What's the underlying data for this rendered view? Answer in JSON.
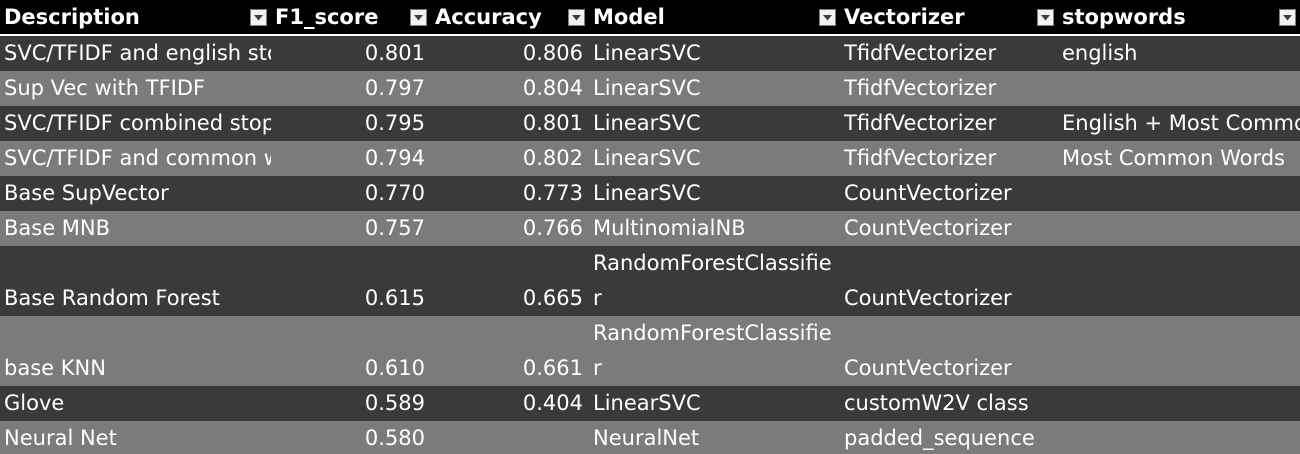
{
  "columns": [
    {
      "label": "Description"
    },
    {
      "label": "F1_score"
    },
    {
      "label": "Accuracy"
    },
    {
      "label": "Model"
    },
    {
      "label": "Vectorizer"
    },
    {
      "label": "stopwords"
    }
  ],
  "rows": [
    {
      "description": "SVC/TFIDF and english stopwords",
      "f1": "0.801",
      "accuracy": "0.806",
      "model": "LinearSVC",
      "vectorizer": "TfidfVectorizer",
      "stopwords": "english"
    },
    {
      "description": "Sup Vec with TFIDF",
      "f1": "0.797",
      "accuracy": "0.804",
      "model": "LinearSVC",
      "vectorizer": "TfidfVectorizer",
      "stopwords": ""
    },
    {
      "description": "SVC/TFIDF combined stopwords",
      "f1": "0.795",
      "accuracy": "0.801",
      "model": "LinearSVC",
      "vectorizer": "TfidfVectorizer",
      "stopwords": "English + Most Common Words"
    },
    {
      "description": "SVC/TFIDF and common words",
      "f1": "0.794",
      "accuracy": "0.802",
      "model": "LinearSVC",
      "vectorizer": "TfidfVectorizer",
      "stopwords": "Most Common Words"
    },
    {
      "description": "Base SupVector",
      "f1": "0.770",
      "accuracy": "0.773",
      "model": "LinearSVC",
      "vectorizer": "CountVectorizer",
      "stopwords": ""
    },
    {
      "description": "Base MNB",
      "f1": "0.757",
      "accuracy": "0.766",
      "model": "MultinomialNB",
      "vectorizer": "CountVectorizer",
      "stopwords": ""
    },
    {
      "description": "Base Random Forest",
      "f1": "0.615",
      "accuracy": "0.665",
      "model": "RandomForestClassifier",
      "vectorizer": "CountVectorizer",
      "stopwords": ""
    },
    {
      "description": "base KNN",
      "f1": "0.610",
      "accuracy": "0.661",
      "model": "RandomForestClassifier",
      "vectorizer": "CountVectorizer",
      "stopwords": ""
    },
    {
      "description": "Glove",
      "f1": "0.589",
      "accuracy": "0.404",
      "model": "LinearSVC",
      "vectorizer": "customW2V class",
      "stopwords": ""
    },
    {
      "description": "Neural Net",
      "f1": "0.580",
      "accuracy": "",
      "model": "NeuralNet",
      "vectorizer": "padded_sequence",
      "stopwords": ""
    }
  ],
  "colors": {
    "header_bg": "#000000",
    "row_dark": "#3a3a3a",
    "row_light": "#7b7b7b",
    "text": "#ffffff"
  },
  "icons": {
    "filter": "dropdown-filter-icon"
  }
}
